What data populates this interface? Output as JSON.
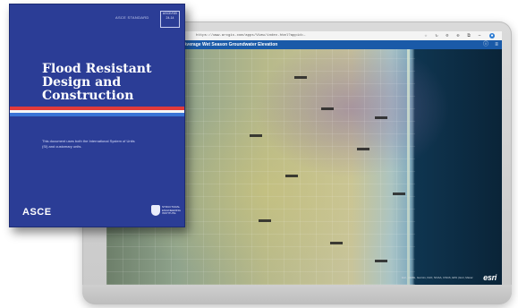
{
  "browser": {
    "url": "https://www.arcgis.com/apps/View/index.html?appid=…",
    "toolbar_icons": [
      "star-icon",
      "refresh-icon",
      "extensions-icon",
      "bookmark-icon",
      "tabs-icon",
      "menu-icon"
    ]
  },
  "map_app": {
    "title": "Average Wet Season Groundwater Elevation",
    "attribution": "Esri, HERE, Garmin, FAO, NOAA, USGS, EPA | Esri, Maxar",
    "logo": "esri"
  },
  "book": {
    "series": "ASCE STANDARD",
    "std_line1": "ASCE/SEI",
    "std_line2": "24-14",
    "title_lines": [
      "Flood Resistant",
      "Design and",
      "Construction"
    ],
    "blurb": "This document uses both the International System of Units (SI) and customary units.",
    "publisher": "ASCE",
    "sei_text": "STRUCTURAL ENGINEERING INSTITUTE"
  },
  "colors": {
    "book_blue": "#2b3d96",
    "accent_red": "#e23a3a",
    "app_bar": "#1a5aa8",
    "ocean": "#0a2438"
  }
}
